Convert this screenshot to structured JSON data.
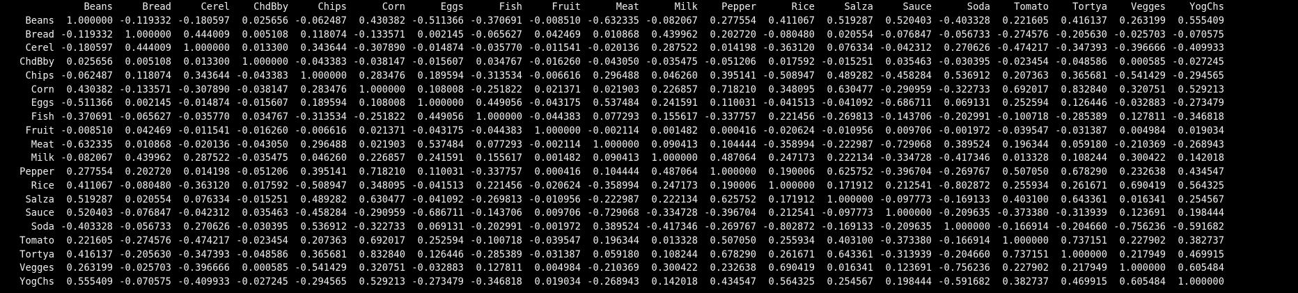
{
  "columns": [
    "Beans",
    "Bread",
    "Cerel",
    "ChdBby",
    "Chips",
    "Corn",
    "Eggs",
    "Fish",
    "Fruit",
    "Meat",
    "Milk",
    "Pepper",
    "Rice",
    "Salza",
    "Sauce",
    "Soda",
    "Tomato",
    "Tortya",
    "Vegges",
    "YogChs"
  ],
  "rows": [
    {
      "label": "Beans",
      "values": [
        "1.000000",
        "-0.119332",
        "-0.180597",
        "0.025656",
        "-0.062487",
        "0.430382",
        "-0.511366",
        "-0.370691",
        "-0.008510",
        "-0.632335",
        "-0.082067",
        "0.277554",
        "0.411067",
        "0.519287",
        "0.520403",
        "-0.403328",
        "0.221605",
        "0.416137",
        "0.263199",
        "0.555409"
      ]
    },
    {
      "label": "Bread",
      "values": [
        "-0.119332",
        "1.000000",
        "0.444009",
        "0.005108",
        "0.118074",
        "-0.133571",
        "0.002145",
        "-0.065627",
        "0.042469",
        "0.010868",
        "0.439962",
        "0.202720",
        "-0.080480",
        "0.020554",
        "-0.076847",
        "-0.056733",
        "-0.274576",
        "-0.205630",
        "-0.025703",
        "-0.070575"
      ]
    },
    {
      "label": "Cerel",
      "values": [
        "-0.180597",
        "0.444009",
        "1.000000",
        "0.013300",
        "0.343644",
        "-0.307890",
        "-0.014874",
        "-0.035770",
        "-0.011541",
        "-0.020136",
        "0.287522",
        "0.014198",
        "-0.363120",
        "0.076334",
        "-0.042312",
        "0.270626",
        "-0.474217",
        "-0.347393",
        "-0.396666",
        "-0.409933"
      ]
    },
    {
      "label": "ChdBby",
      "values": [
        "0.025656",
        "0.005108",
        "0.013300",
        "1.000000",
        "-0.043383",
        "-0.038147",
        "-0.015607",
        "0.034767",
        "-0.016260",
        "-0.043050",
        "-0.035475",
        "-0.051206",
        "0.017592",
        "-0.015251",
        "0.035463",
        "-0.030395",
        "-0.023454",
        "-0.048586",
        "0.000585",
        "-0.027245"
      ]
    },
    {
      "label": "Chips",
      "values": [
        "-0.062487",
        "0.118074",
        "0.343644",
        "-0.043383",
        "1.000000",
        "0.283476",
        "0.189594",
        "-0.313534",
        "-0.006616",
        "0.296488",
        "0.046260",
        "0.395141",
        "-0.508947",
        "0.489282",
        "-0.458284",
        "0.536912",
        "0.207363",
        "0.365681",
        "-0.541429",
        "-0.294565"
      ]
    },
    {
      "label": "Corn",
      "values": [
        "0.430382",
        "-0.133571",
        "-0.307890",
        "-0.038147",
        "0.283476",
        "1.000000",
        "0.108008",
        "-0.251822",
        "0.021371",
        "0.021903",
        "0.226857",
        "0.718210",
        "0.348095",
        "0.630477",
        "-0.290959",
        "-0.322733",
        "0.692017",
        "0.832840",
        "0.320751",
        "0.529213"
      ]
    },
    {
      "label": "Eggs",
      "values": [
        "-0.511366",
        "0.002145",
        "-0.014874",
        "-0.015607",
        "0.189594",
        "0.108008",
        "1.000000",
        "0.449056",
        "-0.043175",
        "0.537484",
        "0.241591",
        "0.110031",
        "-0.041513",
        "-0.041092",
        "-0.686711",
        "0.069131",
        "0.252594",
        "0.126446",
        "-0.032883",
        "-0.273479"
      ]
    },
    {
      "label": "Fish",
      "values": [
        "-0.370691",
        "-0.065627",
        "-0.035770",
        "0.034767",
        "-0.313534",
        "-0.251822",
        "0.449056",
        "1.000000",
        "-0.044383",
        "0.077293",
        "0.155617",
        "-0.337757",
        "0.221456",
        "-0.269813",
        "-0.143706",
        "-0.202991",
        "-0.100718",
        "-0.285389",
        "0.127811",
        "-0.346818"
      ]
    },
    {
      "label": "Fruit",
      "values": [
        "-0.008510",
        "0.042469",
        "-0.011541",
        "-0.016260",
        "-0.006616",
        "0.021371",
        "-0.043175",
        "-0.044383",
        "1.000000",
        "-0.002114",
        "0.001482",
        "0.000416",
        "-0.020624",
        "-0.010956",
        "0.009706",
        "-0.001972",
        "-0.039547",
        "-0.031387",
        "0.004984",
        "0.019034"
      ]
    },
    {
      "label": "Meat",
      "values": [
        "-0.632335",
        "0.010868",
        "-0.020136",
        "-0.043050",
        "0.296488",
        "0.021903",
        "0.537484",
        "0.077293",
        "-0.002114",
        "1.000000",
        "0.090413",
        "0.104444",
        "-0.358994",
        "-0.222987",
        "-0.729068",
        "0.389524",
        "0.196344",
        "0.059180",
        "-0.210369",
        "-0.268943"
      ]
    },
    {
      "label": "Milk",
      "values": [
        "-0.082067",
        "0.439962",
        "0.287522",
        "-0.035475",
        "0.046260",
        "0.226857",
        "0.241591",
        "0.155617",
        "0.001482",
        "0.090413",
        "1.000000",
        "0.487064",
        "0.247173",
        "0.222134",
        "-0.334728",
        "-0.417346",
        "0.013328",
        "0.108244",
        "0.300422",
        "0.142018"
      ]
    },
    {
      "label": "Pepper",
      "values": [
        "0.277554",
        "0.202720",
        "0.014198",
        "-0.051206",
        "0.395141",
        "0.718210",
        "0.110031",
        "-0.337757",
        "0.000416",
        "0.104444",
        "0.487064",
        "1.000000",
        "0.190006",
        "0.625752",
        "-0.396704",
        "-0.269767",
        "0.507050",
        "0.678290",
        "0.232638",
        "0.434547"
      ]
    },
    {
      "label": "Rice",
      "values": [
        "0.411067",
        "-0.080480",
        "-0.363120",
        "0.017592",
        "-0.508947",
        "0.348095",
        "-0.041513",
        "0.221456",
        "-0.020624",
        "-0.358994",
        "0.247173",
        "0.190006",
        "1.000000",
        "0.171912",
        "0.212541",
        "-0.802872",
        "0.255934",
        "0.261671",
        "0.690419",
        "0.564325"
      ]
    },
    {
      "label": "Salza",
      "values": [
        "0.519287",
        "0.020554",
        "0.076334",
        "-0.015251",
        "0.489282",
        "0.630477",
        "-0.041092",
        "-0.269813",
        "-0.010956",
        "-0.222987",
        "0.222134",
        "0.625752",
        "0.171912",
        "1.000000",
        "-0.097773",
        "-0.169133",
        "0.403100",
        "0.643361",
        "0.016341",
        "0.254567"
      ]
    },
    {
      "label": "Sauce",
      "values": [
        "0.520403",
        "-0.076847",
        "-0.042312",
        "0.035463",
        "-0.458284",
        "-0.290959",
        "-0.686711",
        "-0.143706",
        "0.009706",
        "-0.729068",
        "-0.334728",
        "-0.396704",
        "0.212541",
        "-0.097773",
        "1.000000",
        "-0.209635",
        "-0.373380",
        "-0.313939",
        "0.123691",
        "0.198444"
      ]
    },
    {
      "label": "Soda",
      "values": [
        "-0.403328",
        "-0.056733",
        "0.270626",
        "-0.030395",
        "0.536912",
        "-0.322733",
        "0.069131",
        "-0.202991",
        "-0.001972",
        "0.389524",
        "-0.417346",
        "-0.269767",
        "-0.802872",
        "-0.169133",
        "-0.209635",
        "1.000000",
        "-0.166914",
        "-0.204660",
        "-0.756236",
        "-0.591682"
      ]
    },
    {
      "label": "Tomato",
      "values": [
        "0.221605",
        "-0.274576",
        "-0.474217",
        "-0.023454",
        "0.207363",
        "0.692017",
        "0.252594",
        "-0.100718",
        "-0.039547",
        "0.196344",
        "0.013328",
        "0.507050",
        "0.255934",
        "0.403100",
        "-0.373380",
        "-0.166914",
        "1.000000",
        "0.737151",
        "0.227902",
        "0.382737"
      ]
    },
    {
      "label": "Tortya",
      "values": [
        "0.416137",
        "-0.205630",
        "-0.347393",
        "-0.048586",
        "0.365681",
        "0.832840",
        "0.126446",
        "-0.285389",
        "-0.031387",
        "0.059180",
        "0.108244",
        "0.678290",
        "0.261671",
        "0.643361",
        "-0.313939",
        "-0.204660",
        "0.737151",
        "1.000000",
        "0.217949",
        "0.469915"
      ]
    },
    {
      "label": "Vegges",
      "values": [
        "0.263199",
        "-0.025703",
        "-0.396666",
        "0.000585",
        "-0.541429",
        "0.320751",
        "-0.032883",
        "0.127811",
        "0.004984",
        "-0.210369",
        "0.300422",
        "0.232638",
        "0.690419",
        "0.016341",
        "0.123691",
        "-0.756236",
        "0.227902",
        "0.217949",
        "1.000000",
        "0.605484"
      ]
    },
    {
      "label": "YogChs",
      "values": [
        "0.555409",
        "-0.070575",
        "-0.409933",
        "-0.027245",
        "-0.294565",
        "0.529213",
        "-0.273479",
        "-0.346818",
        "0.019034",
        "-0.268943",
        "0.142018",
        "0.434547",
        "0.564325",
        "0.254567",
        "0.198444",
        "-0.591682",
        "0.382737",
        "0.469915",
        "0.605484",
        "1.000000"
      ]
    }
  ]
}
